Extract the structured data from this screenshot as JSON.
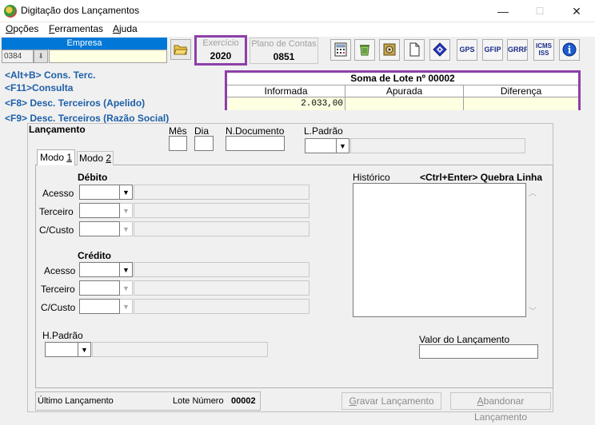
{
  "window": {
    "title": "Digitação dos Lançamentos",
    "min_glyph": "—",
    "max_glyph": "☐",
    "close_glyph": "✕"
  },
  "menu": {
    "opcoes": {
      "first": "O",
      "rest": "pções"
    },
    "ferramentas": {
      "first": "F",
      "rest": "erramentas"
    },
    "ajuda": {
      "first": "A",
      "rest": "juda"
    }
  },
  "toolbar": {
    "empresa_label": "Empresa",
    "empresa_code": "0384",
    "exercicio_label": "Exercício",
    "exercicio_value": "2020",
    "plano_label": "Plano de Contas",
    "plano_value": "0851",
    "buttons": {
      "gps": "GPS",
      "gfip": "GFIP",
      "grrf": "GRRF",
      "icms_iss": "ICMS ISS",
      "info": "i"
    }
  },
  "shortcuts": [
    "<Alt+B> Cons. Terc.",
    "<F11>Consulta",
    "<F8> Desc. Terceiros (Apelido)",
    "<F9> Desc. Terceiros (Razão Social)"
  ],
  "soma_lote": {
    "title": "Soma de Lote nº 00002",
    "headers": [
      "Informada",
      "Apurada",
      "Diferença"
    ],
    "values": [
      "2.033,00",
      "",
      ""
    ]
  },
  "lancamento": {
    "title": "Lançamento",
    "mes_label": "Mês",
    "dia_label": "Dia",
    "ndoc_label": "N.Documento",
    "lpadrao_label": "L.Padrão"
  },
  "tabs": {
    "modo1": {
      "prefix": "Modo ",
      "key": "1"
    },
    "modo2": {
      "prefix": "Modo ",
      "key": "2"
    }
  },
  "debito": {
    "title": "Débito",
    "acesso": "Acesso",
    "terceiro": "Terceiro",
    "ccusto": "C/Custo"
  },
  "credito": {
    "title": "Crédito",
    "acesso": "Acesso",
    "terceiro": "Terceiro",
    "ccusto": "C/Custo"
  },
  "historico": {
    "label": "Histórico",
    "hint": "<Ctrl+Enter> Quebra Linha"
  },
  "hpadrao_label": "H.Padrão",
  "valor_label": "Valor do Lançamento",
  "footer": {
    "ultimo_label": "Último Lançamento",
    "lote_label": "Lote Número",
    "lote_value": "00002",
    "gravar": {
      "first": "G",
      "rest": "ravar Lançamento"
    },
    "abandonar": {
      "first": "A",
      "rest": "bandonar Lançamento"
    }
  },
  "colors": {
    "highlight_border": "#8e3fa8",
    "link_blue": "#1d5fa8",
    "selection_blue": "#0078d7",
    "input_yellow": "#ffffe1"
  }
}
